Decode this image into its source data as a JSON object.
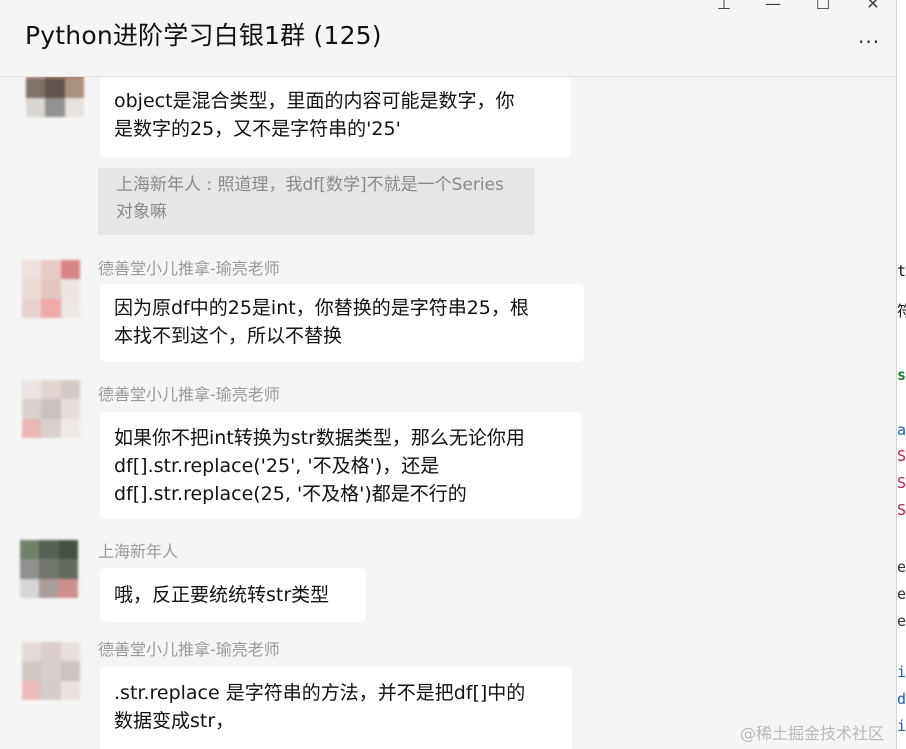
{
  "window": {
    "title": "Python进阶学习白银1群 (125)",
    "controls": {
      "pin": "⊥",
      "minimize": "—",
      "maximize": "☐",
      "close": "✕"
    },
    "more_icon": "···"
  },
  "messages": [
    {
      "type": "bubble",
      "sender": "",
      "text_lines": [
        "object是混合类型，里面的内容可能是数字，你",
        "是数字的25，又不是字符串的'25'"
      ]
    },
    {
      "type": "quote",
      "text_lines": [
        "上海新年人 : 照道理，我df[数学]不就是一个Series",
        "对象嘛"
      ]
    },
    {
      "type": "bubble",
      "sender": "德善堂小儿推拿-瑜亮老师",
      "text_lines": [
        "因为原df中的25是int，你替换的是字符串25，根",
        "本找不到这个，所以不替换"
      ]
    },
    {
      "type": "bubble",
      "sender": "德善堂小儿推拿-瑜亮老师",
      "text_lines": [
        "如果你不把int转换为str数据类型，那么无论你用",
        "df[].str.replace('25', '不及格')，还是",
        "df[].str.replace(25, '不及格')都是不行的"
      ]
    },
    {
      "type": "bubble",
      "sender": "上海新年人",
      "text_lines": [
        "哦，反正要统统转str类型"
      ]
    },
    {
      "type": "bubble",
      "sender": "德善堂小儿推拿-瑜亮老师",
      "text_lines": [
        ".str.replace 是字符串的方法，并不是把df[]中的",
        "数据变成str，"
      ]
    }
  ],
  "right_strip_chars": [
    "ti",
    "符",
    "s",
    "a",
    "S",
    "S",
    "S",
    "e",
    "e",
    "e",
    "i",
    "d",
    "i"
  ],
  "watermark": "@稀土掘金技术社区"
}
